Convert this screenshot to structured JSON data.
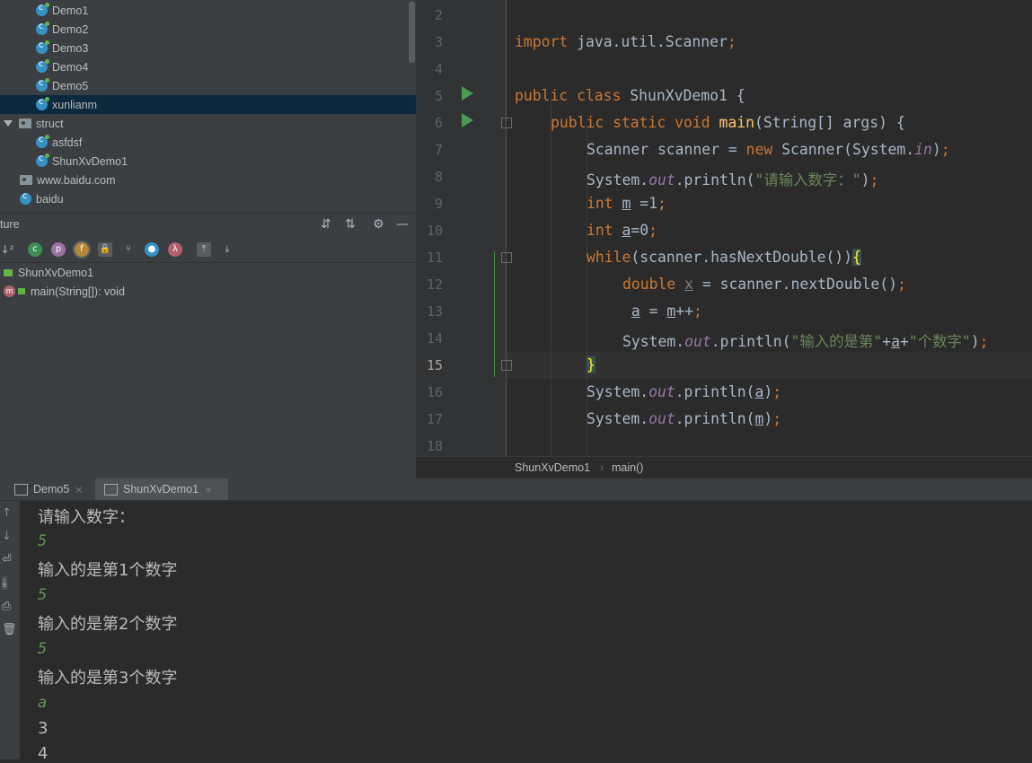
{
  "project_tree": {
    "items": [
      {
        "label": "Demo1"
      },
      {
        "label": "Demo2"
      },
      {
        "label": "Demo3"
      },
      {
        "label": "Demo4"
      },
      {
        "label": "Demo5"
      },
      {
        "label": "xunlianm"
      },
      {
        "label": "struct"
      },
      {
        "label": "asfdsf"
      },
      {
        "label": "ShunXvDemo1"
      },
      {
        "label": "www.baidu.com"
      },
      {
        "label": "baidu"
      }
    ]
  },
  "structure": {
    "title": "ture",
    "class_name": "ShunXvDemo1",
    "method": "main(String[]): void",
    "toolbar_icons": [
      "sort-visibility-icon",
      "field-c-icon",
      "property-p-icon",
      "field-f-icon",
      "lock-icon",
      "inherited-icon",
      "anonymous-icon",
      "lambda-icon",
      "expand-icon",
      "collapse-icon"
    ]
  },
  "editor": {
    "line_numbers": [
      "2",
      "3",
      "4",
      "5",
      "6",
      "7",
      "8",
      "9",
      "10",
      "11",
      "12",
      "13",
      "14",
      "15",
      "16",
      "17",
      "18"
    ],
    "code": {
      "l3_kw": "import",
      "l3_rest": " java.util.Scanner",
      "l3_semi": ";",
      "l5_kw": "public class",
      "l5_rest": " ShunXvDemo1 {",
      "l6_kw1": "public static void",
      "l6_fn": "main",
      "l6_rest": "(String[] args) {",
      "l7_a": "Scanner scanner = ",
      "l7_kw": "new",
      "l7_b": " Scanner(System.",
      "l7_it": "in",
      "l7_c": ")",
      "l7_semi": ";",
      "l8_a": "System.",
      "l8_it": "out",
      "l8_b": ".println(",
      "l8_str": "\"请输入数字：\"",
      "l8_c": ")",
      "l8_semi": ";",
      "l9_kw": "int",
      "l9_var": "m",
      "l9_b": " =1",
      "l9_semi": ";",
      "l10_kw": "int",
      "l10_var": "a",
      "l10_b": "=0",
      "l10_semi": ";",
      "l11_kw": "while",
      "l11_rest": "(scanner.hasNextDouble())",
      "l11_brace": "{",
      "l12_kw": "double",
      "l12_var": "x",
      "l12_rest": " = scanner.nextDouble()",
      "l12_semi": ";",
      "l13_var1": "a",
      "l13_mid": " = ",
      "l13_var2": "m",
      "l13_rest": "++",
      "l13_semi": ";",
      "l14_a": "System.",
      "l14_it": "out",
      "l14_b": ".println(",
      "l14_str1": "\"输入的是第\"",
      "l14_c": "+",
      "l14_var": "a",
      "l14_d": "+",
      "l14_str2": "\"个数字\"",
      "l14_e": ")",
      "l14_semi": ";",
      "l15_brace": "}",
      "l16_a": "System.",
      "l16_it": "out",
      "l16_b": ".println(",
      "l16_var": "a",
      "l16_c": ")",
      "l16_semi": ";",
      "l17_a": "System.",
      "l17_it": "out",
      "l17_b": ".println(",
      "l17_var": "m",
      "l17_c": ")",
      "l17_semi": ";"
    },
    "breadcrumb": {
      "class": "ShunXvDemo1",
      "sep": "›",
      "method": "main()"
    }
  },
  "run_panel": {
    "tabs": [
      {
        "label": "Demo5",
        "close": "×"
      },
      {
        "label": "ShunXvDemo1",
        "close": "×"
      }
    ],
    "console": {
      "lines": [
        "请输入数字：",
        "5",
        "输入的是第1个数字",
        "5",
        "输入的是第2个数字",
        "5",
        "输入的是第3个数字",
        "a",
        "3",
        "4"
      ]
    }
  },
  "colors": {
    "keyword": "#cc7832",
    "string": "#6a8759",
    "field": "#9876aa",
    "function": "#ffc66d",
    "user_input": "#629755",
    "run_green": "#499c54"
  }
}
